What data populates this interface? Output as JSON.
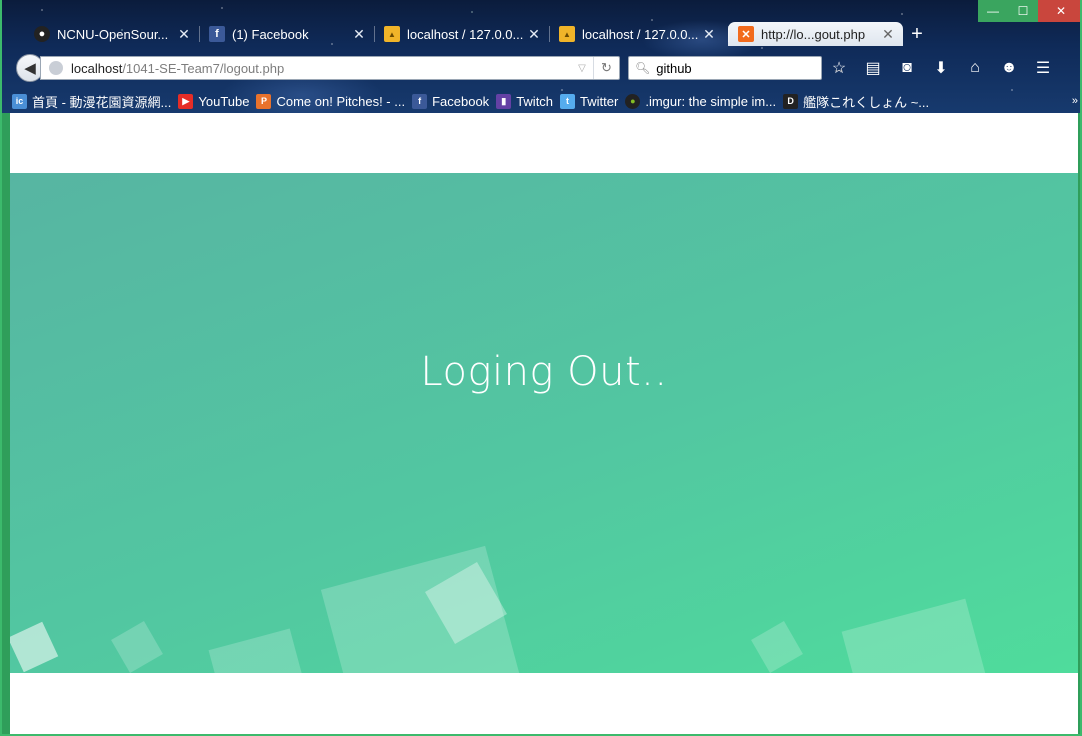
{
  "window": {
    "controls": {
      "minimize": "—",
      "maximize": "☐",
      "close": "✕"
    }
  },
  "tabs": [
    {
      "title": "NCNU-OpenSour...",
      "icon": "github-icon",
      "active": false
    },
    {
      "title": "(1) Facebook",
      "icon": "facebook-icon",
      "active": false
    },
    {
      "title": "localhost / 127.0.0...",
      "icon": "phpmyadmin-icon",
      "active": false
    },
    {
      "title": "localhost / 127.0.0...",
      "icon": "phpmyadmin-icon",
      "active": false
    },
    {
      "title": "http://lo...gout.php",
      "icon": "xampp-icon",
      "active": true
    }
  ],
  "navbar": {
    "url_host": "localhost",
    "url_path": "/1041-SE-Team7/logout.php",
    "search_value": "github"
  },
  "bookmarks": [
    {
      "label": "首頁 - 動漫花園資源網...",
      "icon": "dmhy-icon",
      "color": "#4a8fd6"
    },
    {
      "label": "YouTube",
      "icon": "youtube-icon",
      "color": "#e52d27"
    },
    {
      "label": "Come on! Pitches! - ...",
      "icon": "pitches-icon",
      "color": "#e8722c"
    },
    {
      "label": "Facebook",
      "icon": "facebook-icon",
      "color": "#3b5998"
    },
    {
      "label": "Twitch",
      "icon": "twitch-icon",
      "color": "#6441a5"
    },
    {
      "label": "Twitter",
      "icon": "twitter-icon",
      "color": "#55acee"
    },
    {
      "label": ".imgur: the simple im...",
      "icon": "imgur-icon",
      "color": "#85bf25"
    },
    {
      "label": "艦隊これくしょん ~...",
      "icon": "kancolle-icon",
      "color": "#222222"
    }
  ],
  "page": {
    "heading": "Loging Out..",
    "hero_gradient": [
      "#57b5a2",
      "#4fdc9c"
    ]
  }
}
